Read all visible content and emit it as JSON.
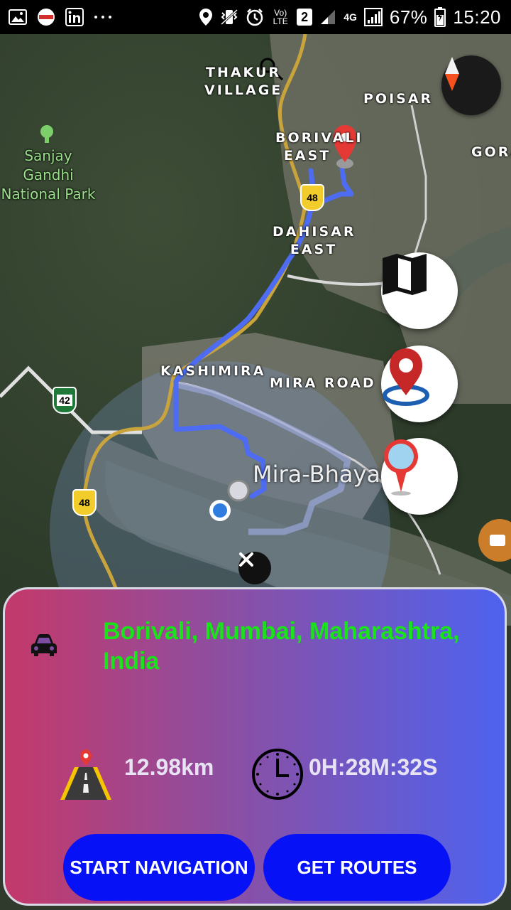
{
  "status_bar": {
    "network_label": "Vo) LTE",
    "sim_slot": "2",
    "network_type": "4G",
    "battery": "67%",
    "time": "15:20",
    "icons": [
      "gallery-icon",
      "news-app-icon",
      "linkedin-icon",
      "more-dots-icon",
      "location-icon",
      "vibrate-icon",
      "alarm-icon",
      "signal-icon",
      "battery-icon"
    ]
  },
  "map": {
    "labels": {
      "thakur_village": "THAKUR VILLAGE",
      "poisar": "POISAR",
      "borivali_east": "BORIVALI EAST",
      "gora": "GORA",
      "dahisar_east": "DAHISAR EAST",
      "kashimira": "KASHIMIRA",
      "mira_road": "MIRA ROAD",
      "mira_bhayandar": "Mira-Bhaya",
      "national_park": "Sanjay Gandhi National Park"
    },
    "shields": {
      "nh48_top": "48",
      "nh42": "42",
      "nh48_bottom": "48"
    },
    "colors": {
      "route": "#4d6cf2",
      "destination_pin": "#e53935"
    }
  },
  "panel": {
    "destination": "Borivali, Mumbai, Maharashtra, India",
    "distance": "12.98km",
    "duration": "0H:28M:32S",
    "start_button": "START NAVIGATION",
    "routes_button": "GET ROUTES",
    "colors": {
      "destination_text": "#19e319",
      "button": "#0612f5"
    }
  }
}
